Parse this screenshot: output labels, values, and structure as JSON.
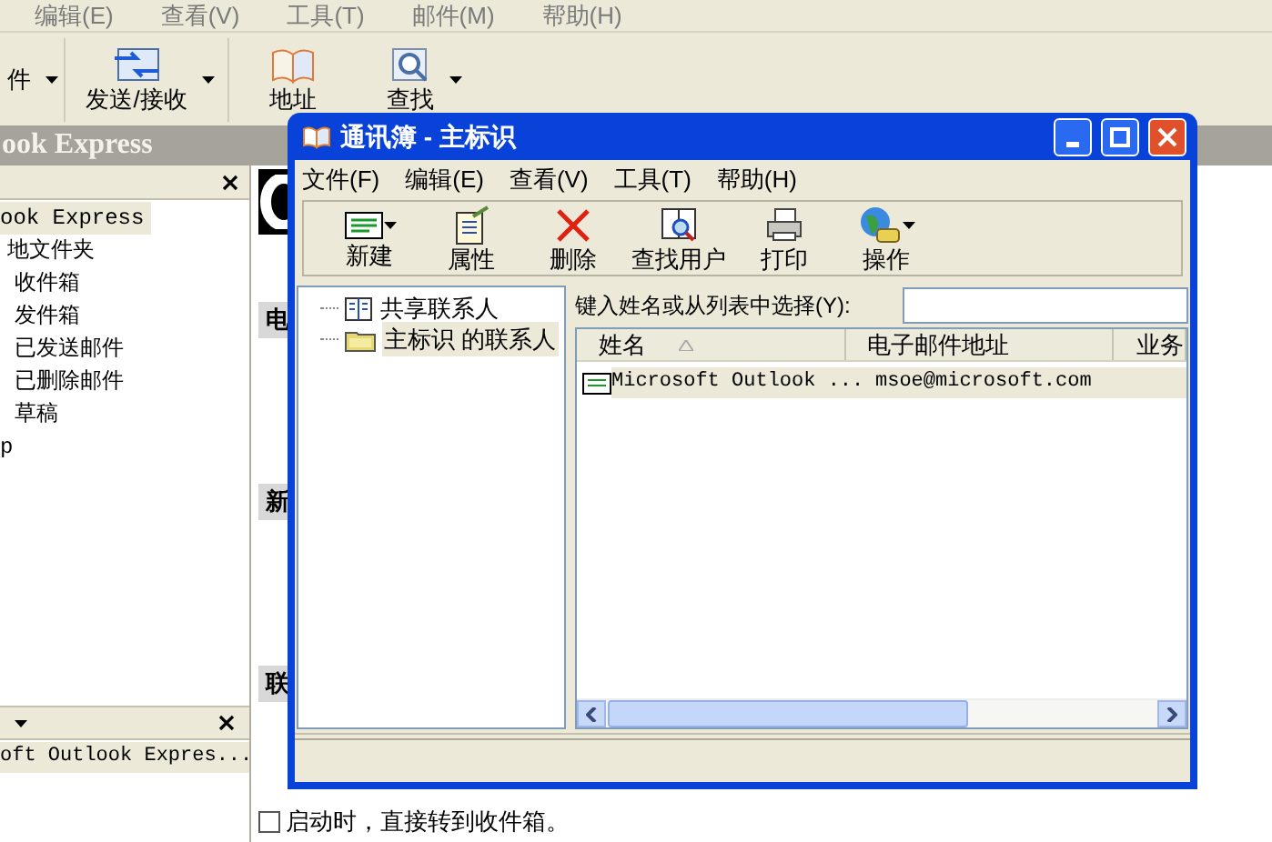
{
  "app": {
    "menu": [
      "编辑(E)",
      "查看(V)",
      "工具(T)",
      "邮件(M)",
      "帮助(H)"
    ],
    "toolbar": [
      {
        "label": "件",
        "dropdown": true
      },
      {
        "label": "发送/接收",
        "dropdown": true,
        "kind": "sendrecv"
      },
      {
        "label": "地址",
        "dropdown": false,
        "kind": "book"
      },
      {
        "label": "查找",
        "dropdown": true,
        "kind": "find"
      }
    ],
    "title": "ook Express",
    "folder_pane": {
      "folders": [
        {
          "label": "ook Express",
          "selected": true,
          "children": [
            {
              "label": "地文件夹",
              "selected": false,
              "children": [
                {
                  "label": "收件箱",
                  "selected": false
                },
                {
                  "label": "发件箱",
                  "selected": false
                },
                {
                  "label": "已发送邮件",
                  "selected": false
                },
                {
                  "label": "已删除邮件",
                  "selected": false
                },
                {
                  "label": "草稿",
                  "selected": false
                }
              ]
            }
          ]
        },
        {
          "label": "p",
          "selected": false
        }
      ]
    },
    "contacts_pane": {
      "contacts": [
        {
          "label": "oft Outlook Expres...",
          "selected": true
        }
      ]
    },
    "content": {
      "sections": [
        "电",
        "新",
        "联"
      ],
      "startup_option": {
        "label": "启动时，直接转到收件箱。",
        "checked": false
      }
    }
  },
  "address_book": {
    "title": "通讯簿 - 主标识",
    "menu": [
      "文件(F)",
      "编辑(E)",
      "查看(V)",
      "工具(T)",
      "帮助(H)"
    ],
    "toolbar": [
      {
        "label": "新建",
        "dropdown": true,
        "kind": "card"
      },
      {
        "label": "属性",
        "dropdown": false,
        "kind": "props"
      },
      {
        "label": "删除",
        "dropdown": false,
        "kind": "delete"
      },
      {
        "label": "查找用户",
        "dropdown": false,
        "kind": "findpeople"
      },
      {
        "label": "打印",
        "dropdown": false,
        "kind": "print"
      },
      {
        "label": "操作",
        "dropdown": true,
        "kind": "globe"
      }
    ],
    "tree": [
      {
        "label": "共享联系人",
        "selected": false,
        "kind": "book"
      },
      {
        "label": "主标识 的联系人",
        "selected": true,
        "kind": "folder"
      }
    ],
    "search": {
      "label": "键入姓名或从列表中选择(Y):"
    },
    "columns": [
      "姓名",
      "电子邮件地址",
      "业务"
    ],
    "rows": [
      {
        "name": "Microsoft Outlook ...",
        "email": "msoe@microsoft.com",
        "selected": true
      }
    ]
  }
}
